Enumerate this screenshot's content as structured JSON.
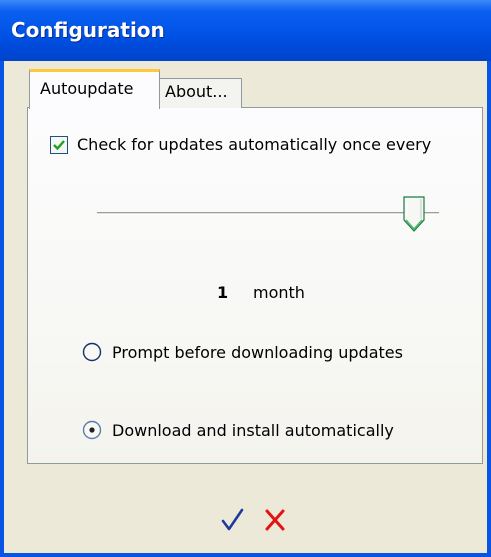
{
  "window": {
    "title": "Configuration"
  },
  "tabs": [
    {
      "label": "Autoupdate",
      "active": true
    },
    {
      "label": "About...",
      "active": false
    }
  ],
  "autoupdate": {
    "check_label": "Check for updates automatically once every",
    "check_checked": true,
    "slider_level": 1.0,
    "interval_value": "1",
    "interval_unit": "month",
    "options": [
      {
        "label": "Prompt before downloading updates",
        "selected": false
      },
      {
        "label": "Download and install automatically",
        "selected": true
      }
    ]
  },
  "footer": {
    "ok_icon": "checkmark-icon",
    "cancel_icon": "x-icon",
    "ok_color": "#1f3a9f",
    "cancel_color": "#e31414"
  },
  "colors": {
    "titlebar": "#0053e6",
    "tab_highlight": "#ffc83c",
    "checkmark": "#21a121"
  }
}
